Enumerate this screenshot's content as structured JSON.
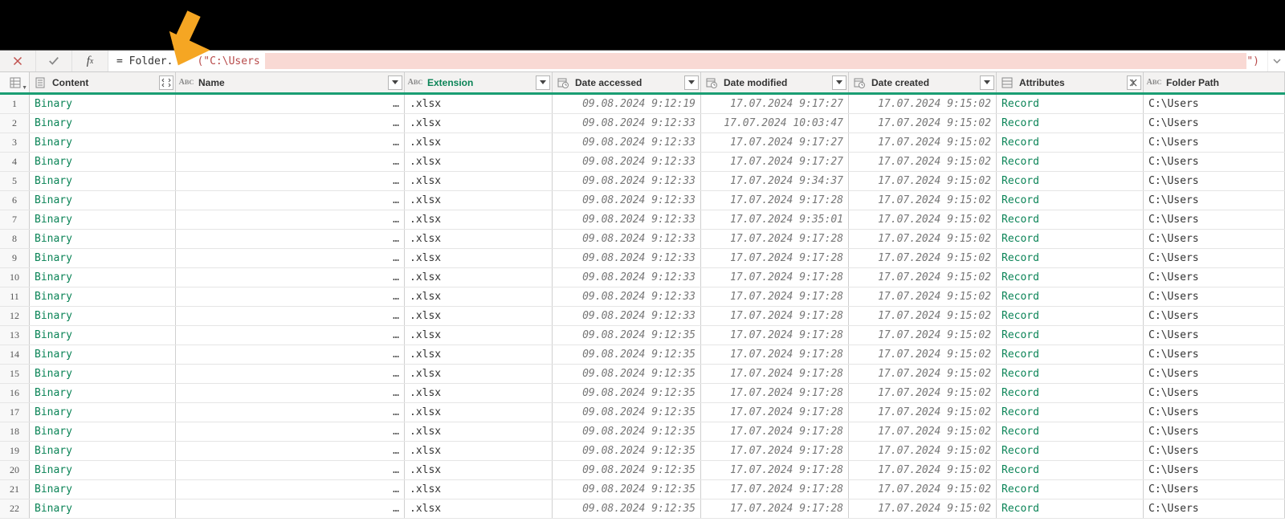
{
  "formula": {
    "prefix": "= Folder.",
    "hidden_mid": true,
    "string_start": "(\"C:\\Users",
    "string_end": "\")"
  },
  "columns": {
    "content": {
      "label": "Content"
    },
    "name": {
      "label": "Name"
    },
    "extension": {
      "label": "Extension"
    },
    "accessed": {
      "label": "Date accessed"
    },
    "modified": {
      "label": "Date modified"
    },
    "created": {
      "label": "Date created"
    },
    "attributes": {
      "label": "Attributes"
    },
    "path": {
      "label": "Folder Path"
    }
  },
  "value_tokens": {
    "binary": "Binary",
    "record": "Record",
    "ellipsis": "…",
    "ext": ".xlsx",
    "folder": "C:\\Users"
  },
  "rows": [
    {
      "n": 1,
      "accessed": "09.08.2024 9:12:19",
      "modified": "17.07.2024 9:17:27",
      "created": "17.07.2024 9:15:02"
    },
    {
      "n": 2,
      "accessed": "09.08.2024 9:12:33",
      "modified": "17.07.2024 10:03:47",
      "created": "17.07.2024 9:15:02"
    },
    {
      "n": 3,
      "accessed": "09.08.2024 9:12:33",
      "modified": "17.07.2024 9:17:27",
      "created": "17.07.2024 9:15:02"
    },
    {
      "n": 4,
      "accessed": "09.08.2024 9:12:33",
      "modified": "17.07.2024 9:17:27",
      "created": "17.07.2024 9:15:02"
    },
    {
      "n": 5,
      "accessed": "09.08.2024 9:12:33",
      "modified": "17.07.2024 9:34:37",
      "created": "17.07.2024 9:15:02"
    },
    {
      "n": 6,
      "accessed": "09.08.2024 9:12:33",
      "modified": "17.07.2024 9:17:28",
      "created": "17.07.2024 9:15:02"
    },
    {
      "n": 7,
      "accessed": "09.08.2024 9:12:33",
      "modified": "17.07.2024 9:35:01",
      "created": "17.07.2024 9:15:02"
    },
    {
      "n": 8,
      "accessed": "09.08.2024 9:12:33",
      "modified": "17.07.2024 9:17:28",
      "created": "17.07.2024 9:15:02"
    },
    {
      "n": 9,
      "accessed": "09.08.2024 9:12:33",
      "modified": "17.07.2024 9:17:28",
      "created": "17.07.2024 9:15:02"
    },
    {
      "n": 10,
      "accessed": "09.08.2024 9:12:33",
      "modified": "17.07.2024 9:17:28",
      "created": "17.07.2024 9:15:02"
    },
    {
      "n": 11,
      "accessed": "09.08.2024 9:12:33",
      "modified": "17.07.2024 9:17:28",
      "created": "17.07.2024 9:15:02"
    },
    {
      "n": 12,
      "accessed": "09.08.2024 9:12:33",
      "modified": "17.07.2024 9:17:28",
      "created": "17.07.2024 9:15:02"
    },
    {
      "n": 13,
      "accessed": "09.08.2024 9:12:35",
      "modified": "17.07.2024 9:17:28",
      "created": "17.07.2024 9:15:02"
    },
    {
      "n": 14,
      "accessed": "09.08.2024 9:12:35",
      "modified": "17.07.2024 9:17:28",
      "created": "17.07.2024 9:15:02"
    },
    {
      "n": 15,
      "accessed": "09.08.2024 9:12:35",
      "modified": "17.07.2024 9:17:28",
      "created": "17.07.2024 9:15:02"
    },
    {
      "n": 16,
      "accessed": "09.08.2024 9:12:35",
      "modified": "17.07.2024 9:17:28",
      "created": "17.07.2024 9:15:02"
    },
    {
      "n": 17,
      "accessed": "09.08.2024 9:12:35",
      "modified": "17.07.2024 9:17:28",
      "created": "17.07.2024 9:15:02"
    },
    {
      "n": 18,
      "accessed": "09.08.2024 9:12:35",
      "modified": "17.07.2024 9:17:28",
      "created": "17.07.2024 9:15:02"
    },
    {
      "n": 19,
      "accessed": "09.08.2024 9:12:35",
      "modified": "17.07.2024 9:17:28",
      "created": "17.07.2024 9:15:02"
    },
    {
      "n": 20,
      "accessed": "09.08.2024 9:12:35",
      "modified": "17.07.2024 9:17:28",
      "created": "17.07.2024 9:15:02"
    },
    {
      "n": 21,
      "accessed": "09.08.2024 9:12:35",
      "modified": "17.07.2024 9:17:28",
      "created": "17.07.2024 9:15:02"
    },
    {
      "n": 22,
      "accessed": "09.08.2024 9:12:35",
      "modified": "17.07.2024 9:17:28",
      "created": "17.07.2024 9:15:02"
    }
  ]
}
